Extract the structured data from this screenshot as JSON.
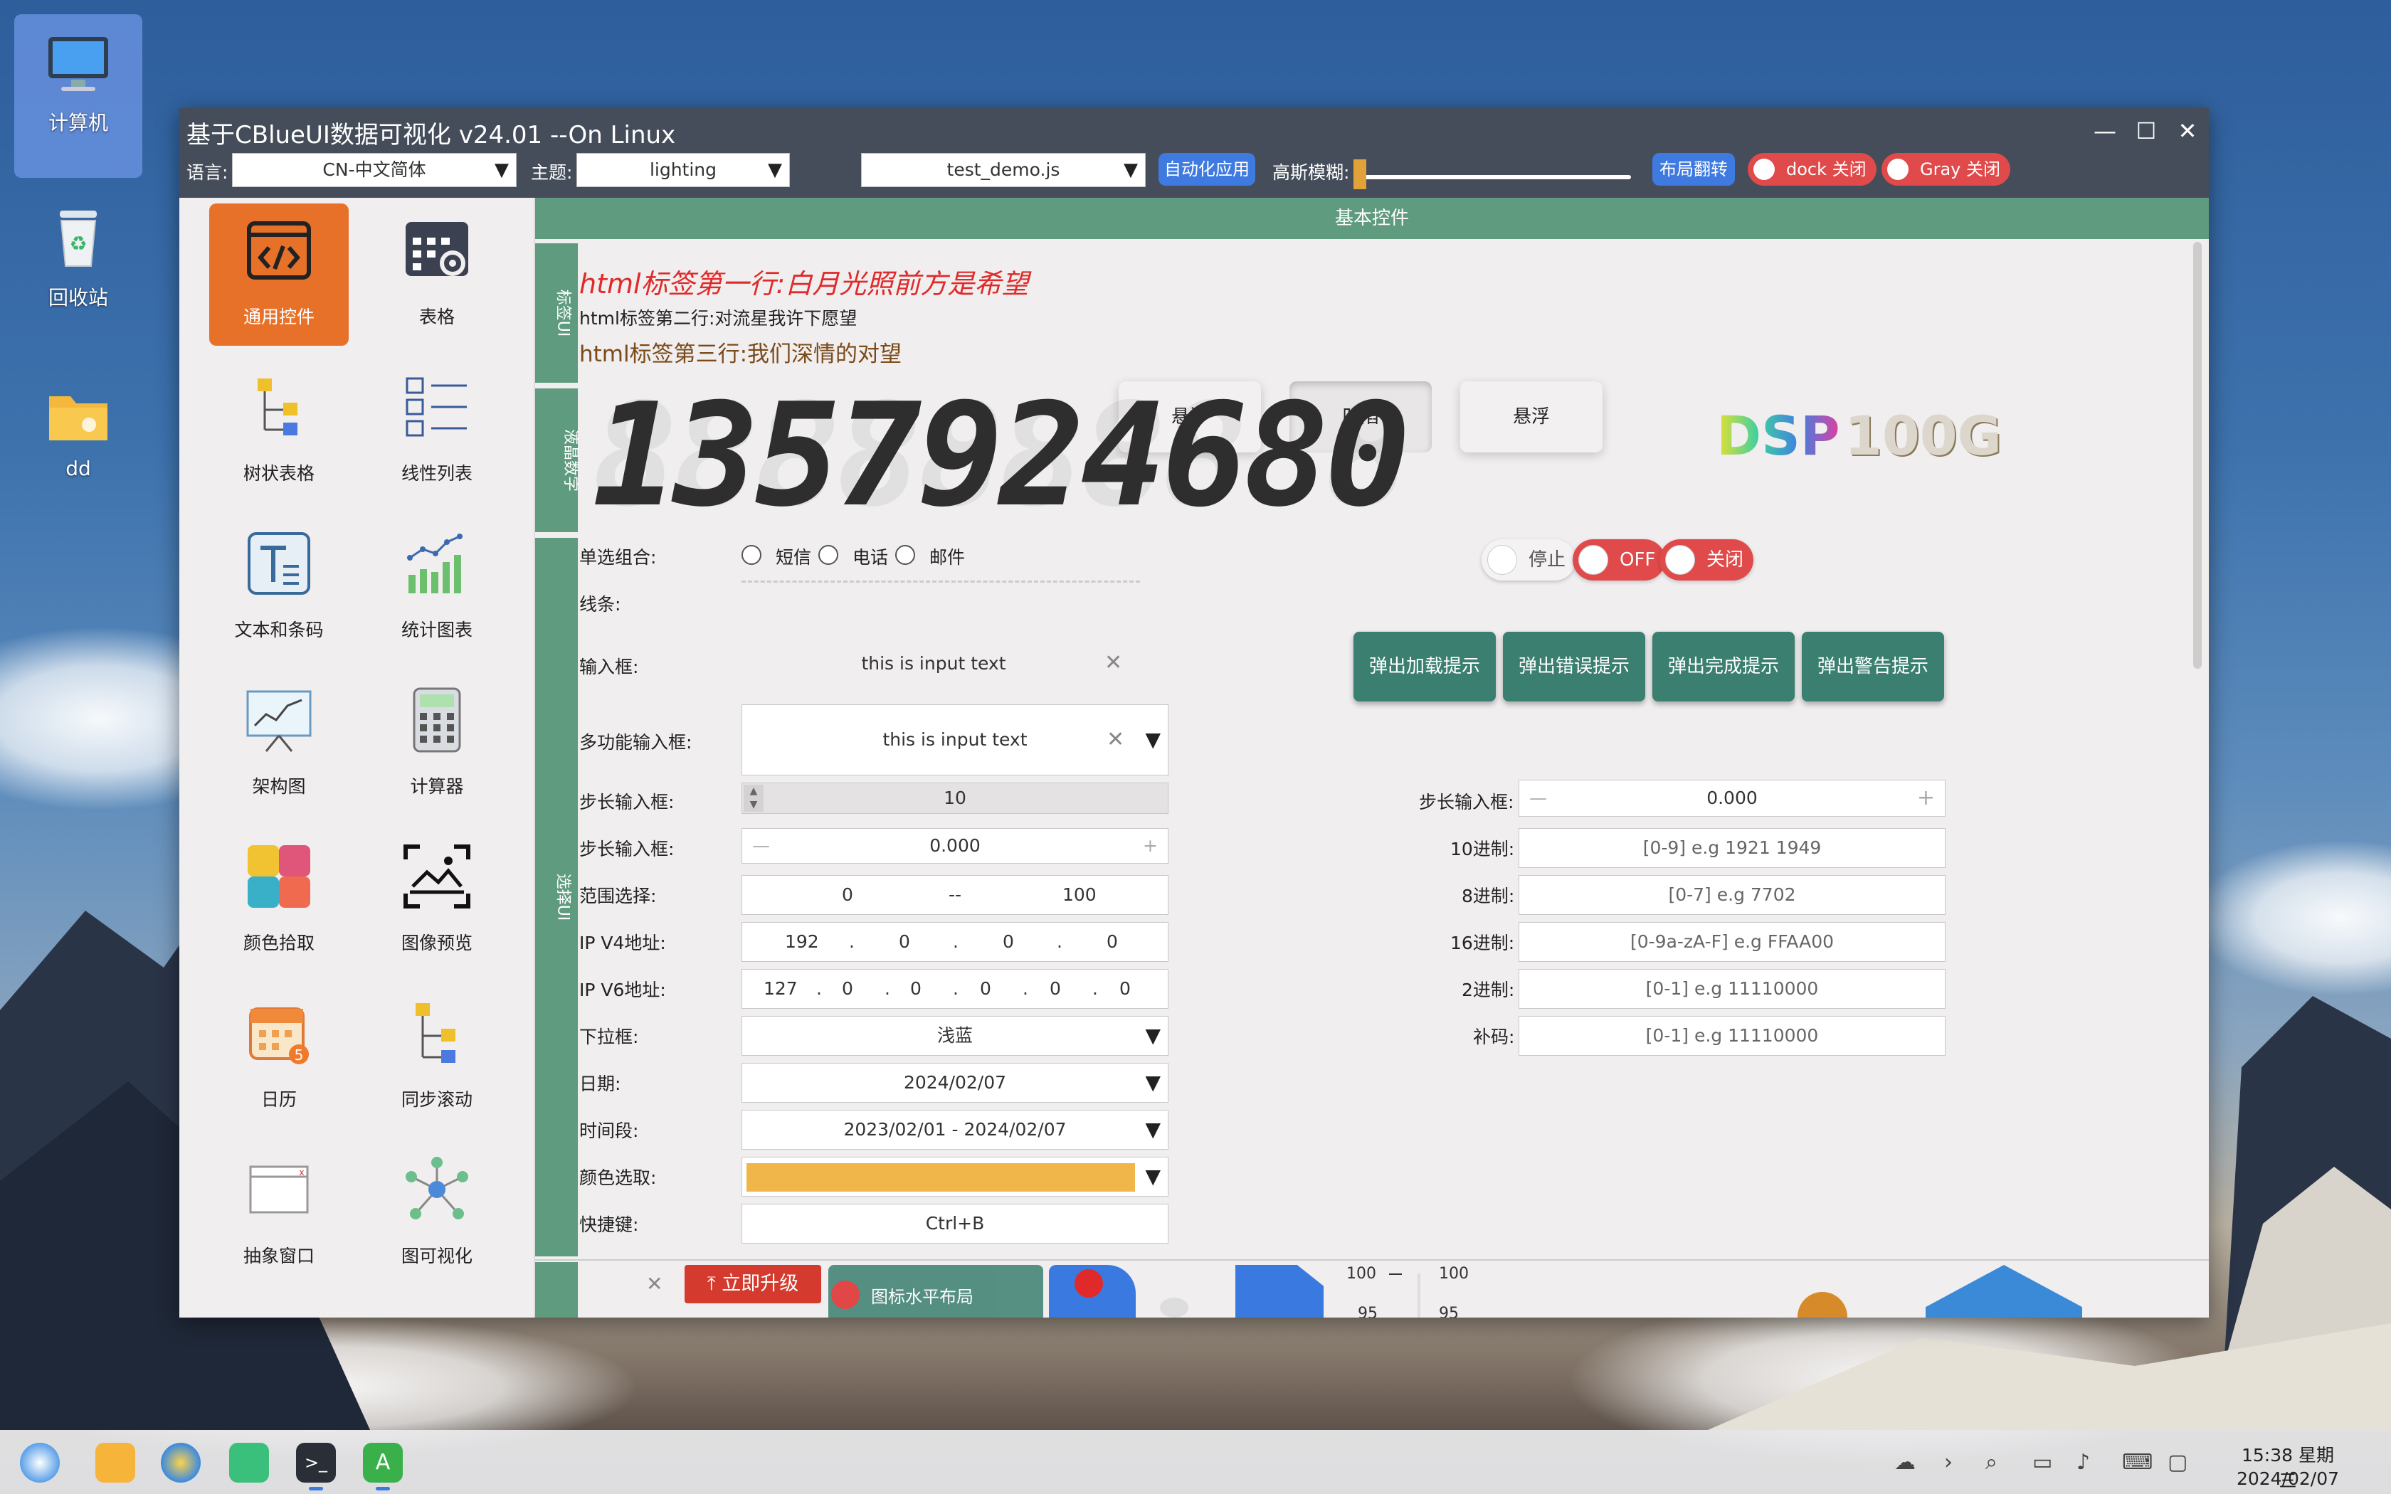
{
  "desktop": {
    "icons": [
      {
        "label": "计算机",
        "icon": "computer-icon"
      },
      {
        "label": "回收站",
        "icon": "recycle-bin-icon"
      },
      {
        "label": "dd",
        "icon": "folder-icon"
      }
    ]
  },
  "window": {
    "title": "基于CBlueUI数据可视化 v24.01 --On Linux",
    "controls": [
      "—",
      "☐",
      "✕"
    ]
  },
  "toolbar": {
    "language_label": "语言:",
    "language_value": "CN-中文简体",
    "theme_label": "主题:",
    "theme_value": "lighting",
    "script_value": "test_demo.js",
    "auto_apply": "自动化应用",
    "blur_label": "高斯模糊:",
    "blur_level": 0.0,
    "layout_flip": "布局翻转",
    "dock_toggle": "dock 关闭",
    "gray_toggle": "Gray 关闭",
    "arrow": "▼"
  },
  "sidebar": {
    "items": [
      {
        "label": "通用控件",
        "icon": "code-icon"
      },
      {
        "label": "表格",
        "icon": "table-settings-icon"
      },
      {
        "label": "树状表格",
        "icon": "tree-table-icon"
      },
      {
        "label": "线性列表",
        "icon": "list-icon"
      },
      {
        "label": "文本和条码",
        "icon": "text-icon"
      },
      {
        "label": "统计图表",
        "icon": "chart-icon"
      },
      {
        "label": "架构图",
        "icon": "presentation-icon"
      },
      {
        "label": "计算器",
        "icon": "calculator-icon"
      },
      {
        "label": "颜色拾取",
        "icon": "color-palette-icon"
      },
      {
        "label": "图像预览",
        "icon": "image-preview-icon"
      },
      {
        "label": "日历",
        "icon": "calendar-icon"
      },
      {
        "label": "同步滚动",
        "icon": "sync-scroll-icon"
      },
      {
        "label": "抽象窗口",
        "icon": "window-icon"
      },
      {
        "label": "图可视化",
        "icon": "graph-icon"
      }
    ],
    "calendar_badge": "5"
  },
  "main": {
    "section_title": "基本控件",
    "vtabs": [
      "标签UI",
      "液晶数字",
      "选择UI"
    ],
    "html_lines": [
      "html标签第一行:白月光照前方是希望",
      "html标签第二行:对流星我许下愿望",
      "html标签第三行:我们深情的对望"
    ],
    "neu_buttons": [
      "悬浮",
      "凹陷",
      "悬浮"
    ],
    "lcd_digits": "1357924680",
    "lcd_ghost": "8888888888",
    "dsp_text_a": "DSP",
    "dsp_text_b": "100G",
    "radio_group": {
      "label": "单选组合:",
      "options": [
        "短信",
        "电话",
        "邮件"
      ]
    },
    "switches": [
      "停止",
      "OFF",
      "关闭"
    ],
    "line_label": "线条:",
    "input": {
      "label": "输入框:",
      "value": "this is input text",
      "clear": "✕"
    },
    "popup_buttons": [
      "弹出加载提示",
      "弹出错误提示",
      "弹出完成提示",
      "弹出警告提示"
    ],
    "multi_input": {
      "label": "多功能输入框:",
      "value": "this is input text"
    },
    "stepper1": {
      "label": "步长输入框:",
      "value": "10"
    },
    "stepper2": {
      "label": "步长输入框:",
      "value": "0.000",
      "minus": "—",
      "plus": "+"
    },
    "stepper3": {
      "label": "步长输入框:",
      "value": "0.000",
      "minus": "—",
      "plus": "+"
    },
    "range": {
      "label": "范围选择:",
      "from": "0",
      "sep": "--",
      "to": "100"
    },
    "ipv4": {
      "label": "IP V4地址:",
      "parts": [
        "192",
        "0",
        "0",
        "0"
      ],
      "dot": "."
    },
    "ipv6": {
      "label": "IP V6地址:",
      "parts": [
        "127",
        "0",
        "0",
        "0",
        "0",
        "0"
      ],
      "dot": "."
    },
    "dropdown": {
      "label": "下拉框:",
      "value": "浅蓝"
    },
    "date": {
      "label": "日期:",
      "value": "2024/02/07"
    },
    "period": {
      "label": "时间段:",
      "value": "2023/02/01 - 2024/02/07"
    },
    "color": {
      "label": "颜色选取:",
      "value": "#f0b64a"
    },
    "shortcut": {
      "label": "快捷键:",
      "value": "Ctrl+B"
    },
    "radix": [
      {
        "label": "10进制:",
        "placeholder": "[0-9] e.g 1921 1949"
      },
      {
        "label": "8进制:",
        "placeholder": "[0-7] e.g 7702"
      },
      {
        "label": "16进制:",
        "placeholder": "[0-9a-zA-F] e.g FFAA00"
      },
      {
        "label": "2进制:",
        "placeholder": "[0-1] e.g 11110000"
      },
      {
        "label": "补码:",
        "placeholder": "[0-1] e.g 11110000"
      }
    ],
    "upgrade": "立即升级",
    "close_x": "✕",
    "icon_layout": "图标水平布局",
    "gauge_ticks": [
      "100",
      "95"
    ],
    "gauge2_ticks": [
      "100",
      "95"
    ]
  },
  "taskbar": {
    "time": "15:38 星期三",
    "date": "2024/02/07"
  },
  "colors": {
    "accent_green": "#5f9b7e",
    "popup_green": "#3a7f70",
    "active_orange": "#e8712a",
    "toggle_red": "#e04a4a",
    "blue": "#3f7ae0"
  }
}
